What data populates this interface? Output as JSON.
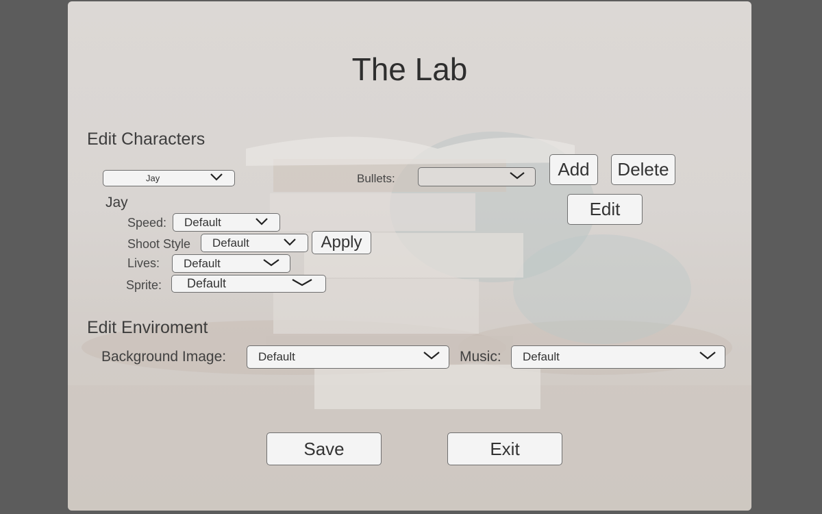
{
  "app": {
    "title": "The Lab"
  },
  "characters": {
    "section_label": "Edit Characters",
    "selected_character": "Jay",
    "character_name": "Jay",
    "bullets_label": "Bullets:",
    "bullets_value": "",
    "add_label": "Add",
    "delete_label": "Delete",
    "edit_label": "Edit",
    "speed_label": "Speed:",
    "speed_value": "Default",
    "shoot_style_label": "Shoot Style",
    "shoot_style_value": "Default",
    "apply_label": "Apply",
    "lives_label": "Lives:",
    "lives_value": "Default",
    "sprite_label": "Sprite:",
    "sprite_value": "Default"
  },
  "environment": {
    "section_label": "Edit Enviroment",
    "background_label": "Background Image:",
    "background_value": "Default",
    "music_label": "Music:",
    "music_value": "Default"
  },
  "footer": {
    "save_label": "Save",
    "exit_label": "Exit"
  },
  "icons": {
    "dropdown": "chevron-down-icon"
  },
  "colors": {
    "page_bg": "#5c5c5c",
    "panel_bg": "#dcd8d5",
    "control_bg": "#f4f4f4",
    "border": "#6e6e6e"
  }
}
